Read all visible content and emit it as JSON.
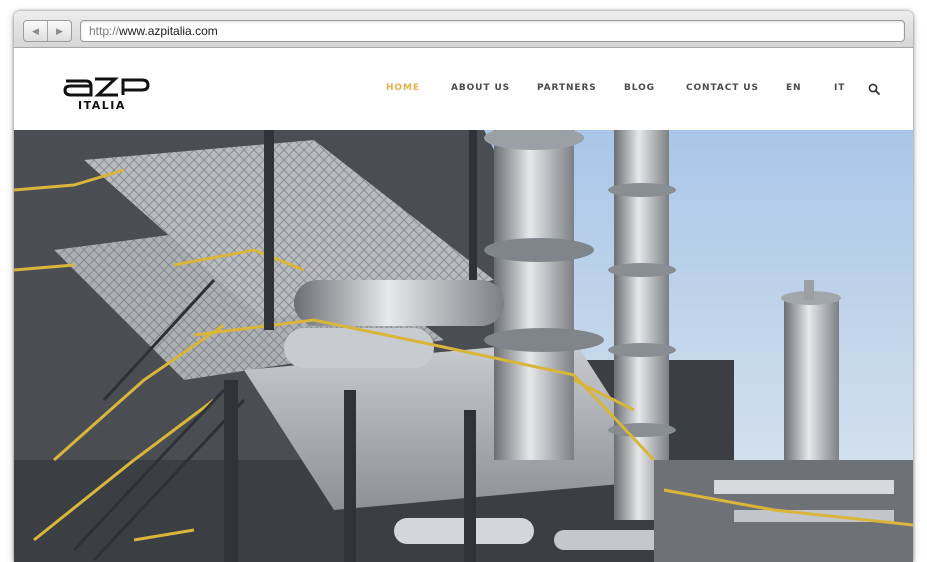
{
  "browser": {
    "url_protocol": "http://",
    "url_host": "www.azpitalia.com",
    "back_icon": "back-arrow-icon",
    "forward_icon": "forward-arrow-icon"
  },
  "site": {
    "logo_text": "aZP",
    "logo_subtext": "ITALIA",
    "nav": [
      {
        "label": "HOME",
        "active": true
      },
      {
        "label": "ABOUT US"
      },
      {
        "label": "PARTNERS"
      },
      {
        "label": "BLOG"
      },
      {
        "label": "CONTACT US"
      },
      {
        "label": "EN"
      },
      {
        "label": "IT"
      }
    ],
    "search_icon": "search-icon",
    "accent_color": "#e2b24a"
  },
  "hero": {
    "image": "industrial refinery with steel structures, yellow railings and distillation columns against a blue sky"
  }
}
